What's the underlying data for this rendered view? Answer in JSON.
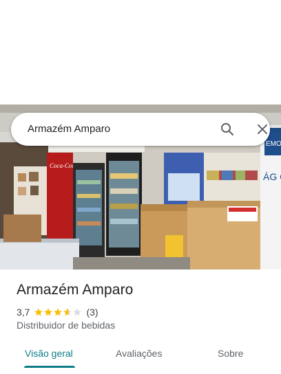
{
  "search": {
    "query": "Armazém Amparo"
  },
  "place": {
    "name": "Armazém Amparo",
    "rating": "3,7",
    "rating_value": 3.7,
    "review_count": "(3)",
    "category": "Distribuidor de bebidas"
  },
  "tabs": [
    {
      "label": "Visão geral",
      "active": true
    },
    {
      "label": "Avaliações",
      "active": false
    },
    {
      "label": "Sobre",
      "active": false
    }
  ],
  "photo": {
    "sign_coca": "Coca-Cola",
    "sign_right": "ÁG GE",
    "sign_top": "EMO"
  },
  "colors": {
    "accent": "#0b7c86",
    "star": "#fbbc04",
    "star_empty": "#dadce0"
  },
  "icons": [
    "search-icon",
    "close-icon",
    "star-icon"
  ]
}
